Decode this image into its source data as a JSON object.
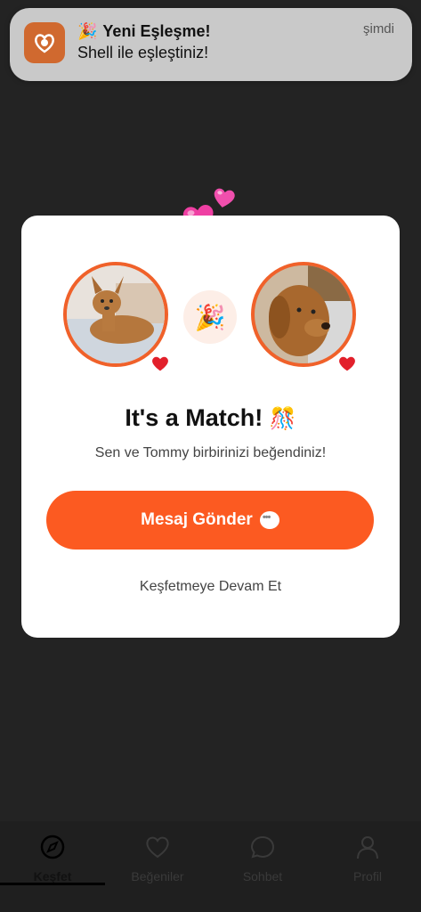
{
  "notification": {
    "emoji": "🎉",
    "title": "Yeni Eşleşme!",
    "body": "Shell ile eşleştiniz!",
    "time": "şimdi",
    "icon": "app-logo-icon"
  },
  "match": {
    "title": "It's a Match!",
    "title_emoji": "🎊",
    "subtitle": "Sen ve Tommy birbirinizi beğendiniz!",
    "party_emoji": "🎉",
    "send_message_label": "Mesaj Gönder",
    "continue_label": "Keşfetmeye Devam Et",
    "heart_emoji": "❤",
    "float_heart": "💗"
  },
  "tabs": [
    {
      "label": "Keşfet",
      "icon": "compass-icon",
      "active": true
    },
    {
      "label": "Beğeniler",
      "icon": "heart-icon",
      "active": false
    },
    {
      "label": "Sohbet",
      "icon": "chat-icon",
      "active": false
    },
    {
      "label": "Profil",
      "icon": "person-icon",
      "active": false
    }
  ],
  "colors": {
    "accent": "#fc5a21",
    "avatar_border": "#f0612a",
    "background": "#232323",
    "notification_icon": "#d0692f"
  }
}
